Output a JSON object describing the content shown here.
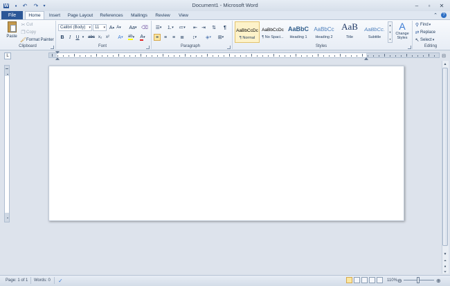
{
  "window": {
    "title": "Document1 - Microsoft Word"
  },
  "quick_access": {
    "icons": [
      "word-logo-icon",
      "save-icon",
      "undo-icon",
      "redo-icon",
      "customize-qat-icon"
    ]
  },
  "tabs": {
    "file": "File",
    "items": [
      "Home",
      "Insert",
      "Page Layout",
      "References",
      "Mailings",
      "Review",
      "View"
    ],
    "active": "Home"
  },
  "clipboard": {
    "paste": "Paste",
    "cut": "Cut",
    "copy": "Copy",
    "format_painter": "Format Painter",
    "group_label": "Clipboard"
  },
  "font": {
    "family": "Calibri (Body)",
    "size": "11",
    "group_label": "Font",
    "change_case": "Aa",
    "buttons": [
      "B",
      "I",
      "U",
      "abc",
      "x₂",
      "x²"
    ],
    "font_color_letter": "A",
    "highlight_letter": "ab"
  },
  "paragraph": {
    "group_label": "Paragraph",
    "pilcrow": "¶"
  },
  "styles": {
    "group_label": "Styles",
    "items": [
      {
        "sample": "AaBbCcDc",
        "name": "¶ Normal"
      },
      {
        "sample": "AaBbCcDc",
        "name": "¶ No Spaci..."
      },
      {
        "sample": "AaBbC",
        "name": "Heading 1"
      },
      {
        "sample": "AaBbCc",
        "name": "Heading 2"
      },
      {
        "sample": "AaB",
        "name": "Title"
      },
      {
        "sample": "AaBbCc.",
        "name": "Subtitle"
      }
    ],
    "change_styles": "Change Styles",
    "change_styles_letter": "A"
  },
  "editing": {
    "group_label": "Editing",
    "find": "Find",
    "replace": "Replace",
    "select": "Select"
  },
  "ruler": {
    "corner_symbol": "L"
  },
  "status": {
    "page": "Page: 1 of 1",
    "words": "Words: 0",
    "zoom": "110%"
  },
  "colors": {
    "file_tab": "#2b5797",
    "ribbon_bg": "#f8fafd",
    "workspace": "#dde3ec",
    "selected_style": "#fdf2c9"
  }
}
